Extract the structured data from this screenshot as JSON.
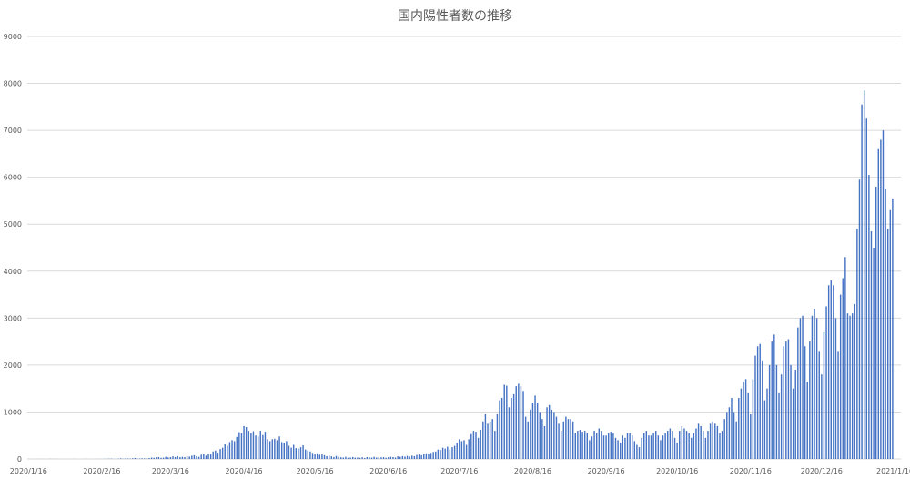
{
  "chart_data": {
    "type": "bar",
    "title": "国内陽性者数の推移",
    "xlabel": "",
    "ylabel": "",
    "ylim": [
      0,
      9000
    ],
    "y_ticks": [
      0,
      1000,
      2000,
      3000,
      4000,
      5000,
      6000,
      7000,
      8000,
      9000
    ],
    "grid": true,
    "legend": "none",
    "color": "#4472c4",
    "x_start": "2020/1/16",
    "x_end": "2021/1/18",
    "x_ticks": [
      "2020/1/16",
      "2020/2/16",
      "2020/3/16",
      "2020/4/16",
      "2020/5/16",
      "2020/6/16",
      "2020/7/16",
      "2020/8/16",
      "2020/9/16",
      "2020/10/16",
      "2020/11/16",
      "2020/12/16",
      "2021/1/16"
    ],
    "series": [
      {
        "values": [
          1,
          0,
          0,
          0,
          1,
          2,
          1,
          1,
          0,
          3,
          1,
          2,
          1,
          1,
          0,
          1,
          0,
          1,
          1,
          1,
          1,
          0,
          0,
          1,
          2,
          1,
          1,
          0,
          1,
          1,
          2,
          1,
          3,
          3,
          6,
          8,
          2,
          4,
          6,
          13,
          4,
          12,
          10,
          8,
          14,
          20,
          8,
          10,
          14,
          12,
          20,
          18,
          30,
          25,
          36,
          40,
          24,
          28,
          45,
          32,
          38,
          55,
          40,
          60,
          38,
          45,
          40,
          60,
          50,
          70,
          80,
          55,
          45,
          90,
          110,
          70,
          100,
          110,
          160,
          180,
          135,
          210,
          240,
          310,
          280,
          360,
          400,
          380,
          470,
          570,
          550,
          700,
          680,
          600,
          550,
          590,
          500,
          480,
          600,
          510,
          580,
          420,
          380,
          420,
          430,
          400,
          480,
          360,
          350,
          380,
          280,
          240,
          300,
          230,
          220,
          250,
          290,
          200,
          180,
          160,
          130,
          100,
          120,
          90,
          95,
          80,
          60,
          70,
          55,
          40,
          65,
          45,
          35,
          30,
          45,
          25,
          30,
          40,
          28,
          30,
          25,
          35,
          20,
          40,
          35,
          28,
          45,
          30,
          42,
          35,
          38,
          25,
          35,
          45,
          40,
          30,
          55,
          45,
          60,
          50,
          65,
          50,
          70,
          60,
          85,
          95,
          80,
          100,
          120,
          110,
          130,
          150,
          160,
          200,
          190,
          240,
          220,
          260,
          200,
          250,
          280,
          350,
          420,
          380,
          400,
          300,
          420,
          530,
          600,
          580,
          450,
          620,
          800,
          950,
          750,
          800,
          850,
          600,
          950,
          1250,
          1300,
          1580,
          1560,
          1100,
          1300,
          1380,
          1550,
          1600,
          1550,
          1450,
          900,
          800,
          1050,
          1200,
          1350,
          1200,
          1000,
          850,
          700,
          1100,
          1150,
          1050,
          1000,
          900,
          750,
          600,
          800,
          900,
          850,
          850,
          800,
          550,
          600,
          620,
          580,
          600,
          550,
          400,
          480,
          600,
          550,
          650,
          600,
          500,
          500,
          550,
          580,
          550,
          450,
          400,
          350,
          500,
          450,
          550,
          550,
          500,
          380,
          300,
          250,
          450,
          550,
          600,
          500,
          500,
          550,
          600,
          500,
          400,
          500,
          550,
          600,
          650,
          600,
          450,
          350,
          600,
          700,
          650,
          600,
          550,
          450,
          550,
          650,
          750,
          700,
          600,
          450,
          600,
          750,
          800,
          750,
          700,
          550,
          600,
          850,
          1000,
          1100,
          1300,
          1000,
          800,
          1300,
          1500,
          1650,
          1700,
          1400,
          950,
          1700,
          2200,
          2400,
          2450,
          2100,
          1250,
          1500,
          2000,
          2500,
          2650,
          2000,
          1400,
          1800,
          2400,
          2500,
          2550,
          2000,
          1500,
          1900,
          2800,
          3000,
          3050,
          2400,
          1650,
          2500,
          3050,
          3200,
          3000,
          2300,
          1800,
          2700,
          3250,
          3700,
          3800,
          3700,
          3000,
          2300,
          3500,
          3850,
          4300,
          3100,
          3050,
          3100,
          3300,
          4900,
          5950,
          7550,
          7850,
          7250,
          6050,
          4850,
          4500,
          5800,
          6600,
          6800,
          7000,
          5750,
          4900,
          5300,
          5550
        ]
      }
    ]
  }
}
